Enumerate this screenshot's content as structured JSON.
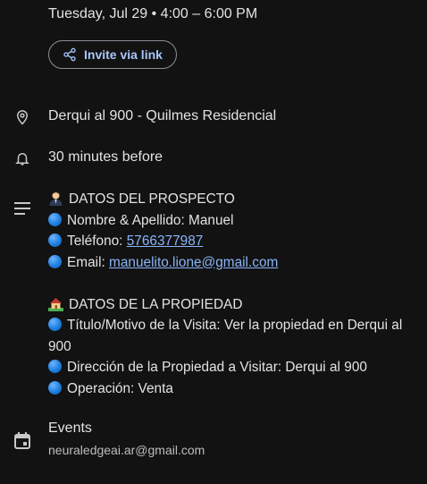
{
  "event": {
    "datetime": "Tuesday, Jul 29  •  4:00 – 6:00 PM",
    "invite_label": "Invite via link",
    "location": "Derqui al 900 - Quilmes Residencial",
    "reminder": "30 minutes before"
  },
  "description": {
    "heading_prospect": "DATOS DEL PROSPECTO",
    "name_label": "Nombre & Apellido: Manuel",
    "phone_label": "Teléfono: ",
    "phone_value": "5766377987",
    "email_label": "Email: ",
    "email_value": "manuelito.lione@gmail.com",
    "heading_property": "DATOS DE LA PROPIEDAD",
    "title_line1": "Título/Motivo de la Visita: Ver la propiedad en Derqui al",
    "title_line2": "900",
    "address_label": "Dirección de la Propiedad a Visitar: Derqui al 900",
    "operation_label": "Operación: Venta"
  },
  "calendar": {
    "name": "Events",
    "owner": "neuraledgeai.ar@gmail.com"
  },
  "colors": {
    "background": "#121212",
    "link": "#8ab4f8",
    "accent": "#a8c7fa"
  },
  "icons": [
    "share-icon",
    "location-pin-icon",
    "bell-icon",
    "description-icon",
    "calendar-icon",
    "person-emoji-icon",
    "house-emoji-icon",
    "blue-circle-emoji-icon"
  ]
}
